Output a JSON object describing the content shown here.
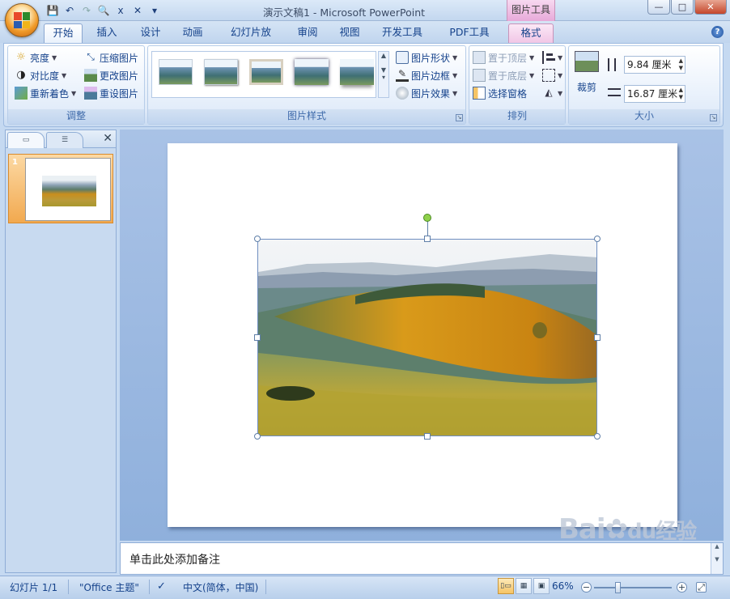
{
  "window": {
    "title": "演示文稿1 - Microsoft PowerPoint",
    "context_tab": "图片工具",
    "buttons": {
      "minimize": "—",
      "maximize": "□",
      "close": "✕"
    }
  },
  "qat": {
    "save": "💾",
    "undo": "↶",
    "redo": "↷",
    "preview": "🔍",
    "extra1": "x",
    "extra2": "✕",
    "customize": "▾"
  },
  "tabs": [
    "开始",
    "插入",
    "设计",
    "动画",
    "幻灯片放映",
    "审阅",
    "视图",
    "开发工具",
    "PDF工具集",
    "格式"
  ],
  "ribbon": {
    "adjust": {
      "label": "调整",
      "brightness": "亮度",
      "contrast": "对比度",
      "recolor": "重新着色",
      "compress": "压缩图片",
      "change": "更改图片",
      "reset": "重设图片"
    },
    "styles": {
      "label": "图片样式",
      "shape": "图片形状",
      "border": "图片边框",
      "effects": "图片效果"
    },
    "arrange": {
      "label": "排列",
      "bring_front": "置于顶层",
      "send_back": "置于底层",
      "selection_pane": "选择窗格"
    },
    "size": {
      "label": "大小",
      "crop": "裁剪",
      "height": "9.84 厘米",
      "width": "16.87 厘米"
    }
  },
  "slides_pane": {
    "slide_number": "1"
  },
  "notes": {
    "placeholder": "单击此处添加备注"
  },
  "status": {
    "slide": "幻灯片 1/1",
    "theme": "\"Office 主题\"",
    "language": "中文(简体，中国)",
    "zoom": "66%"
  },
  "watermark": {
    "text": "Bai",
    "paw": "du",
    "suffix": "经验"
  },
  "colors": {
    "accent": "#15428b",
    "ribbon": "#dfeaf8",
    "format_tab": "#f1c6e6"
  }
}
